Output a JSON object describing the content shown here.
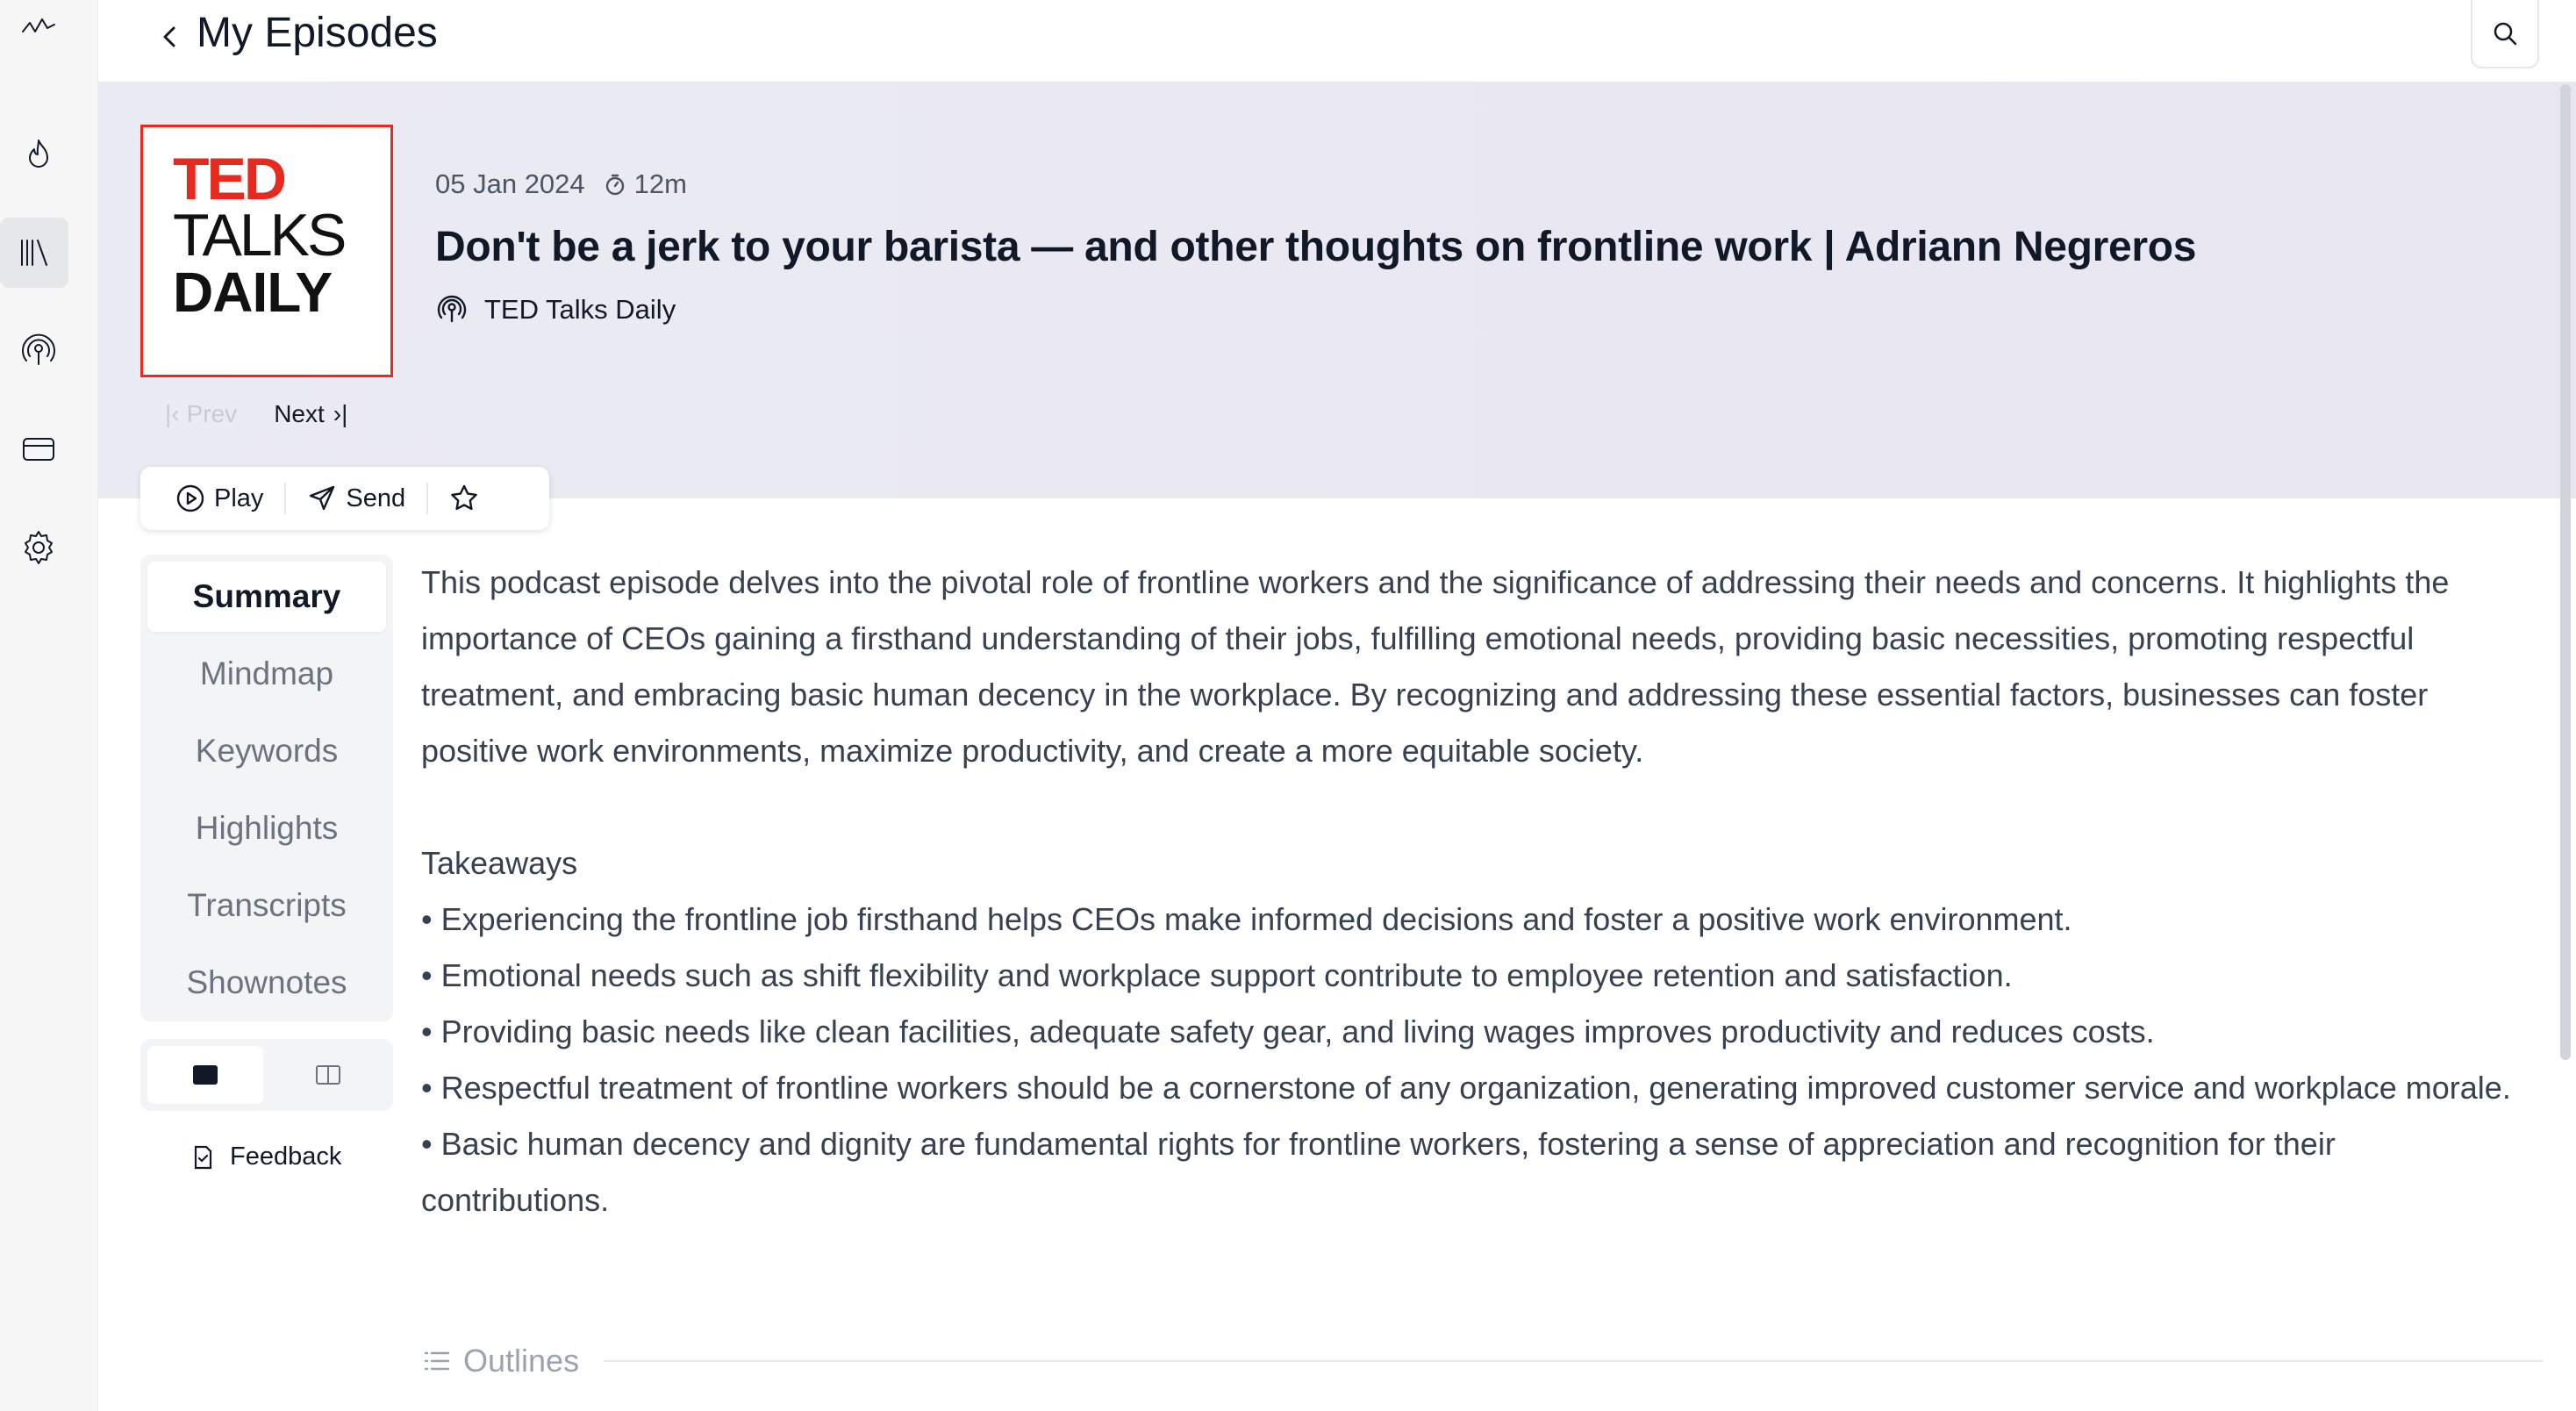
{
  "header": {
    "title": "My Episodes"
  },
  "rail": {
    "items": [
      "logo-icon",
      "trending-icon",
      "library-icon",
      "podcast-icon",
      "card-icon",
      "settings-icon"
    ],
    "active": "library-icon"
  },
  "episode": {
    "cover": {
      "line1": "TED",
      "line2": "TALKS",
      "line3": "DAILY"
    },
    "date": "05 Jan 2024",
    "duration": "12m",
    "title": "Don't be a jerk to your barista — and other thoughts on frontline work | Adriann Negreros",
    "podcast": "TED Talks Daily",
    "prev_label": "Prev",
    "next_label": "Next"
  },
  "actions": {
    "play_label": "Play",
    "send_label": "Send"
  },
  "tabs": [
    {
      "label": "Summary",
      "active": true
    },
    {
      "label": "Mindmap",
      "active": false
    },
    {
      "label": "Keywords",
      "active": false
    },
    {
      "label": "Highlights",
      "active": false
    },
    {
      "label": "Transcripts",
      "active": false
    },
    {
      "label": "Shownotes",
      "active": false
    }
  ],
  "feedback_label": "Feedback",
  "summary": {
    "paragraph": "This podcast episode delves into the pivotal role of frontline workers and the significance of addressing their needs and concerns. It highlights the importance of CEOs gaining a firsthand understanding of their jobs, fulfilling emotional needs, providing basic necessities, promoting respectful treatment, and embracing basic human decency in the workplace. By recognizing and addressing these essential factors, businesses can foster positive work environments, maximize productivity, and create a more equitable society.",
    "takeaways_heading": "Takeaways",
    "takeaways": [
      "• Experiencing the frontline job firsthand helps CEOs make informed decisions and foster a positive work environment.",
      "• Emotional needs such as shift flexibility and workplace support contribute to employee retention and satisfaction.",
      "• Providing basic needs like clean facilities, adequate safety gear, and living wages improves productivity and reduces costs.",
      "• Respectful treatment of frontline workers should be a cornerstone of any organization, generating improved customer service and workplace morale.",
      "• Basic human decency and dignity are fundamental rights for frontline workers, fostering a sense of appreciation and recognition for their contributions."
    ],
    "outlines_label": "Outlines"
  },
  "colors": {
    "ted_red": "#e62b1e",
    "hero_bg": "#ebebf3",
    "text": "#111827",
    "muted": "#6b7280"
  }
}
